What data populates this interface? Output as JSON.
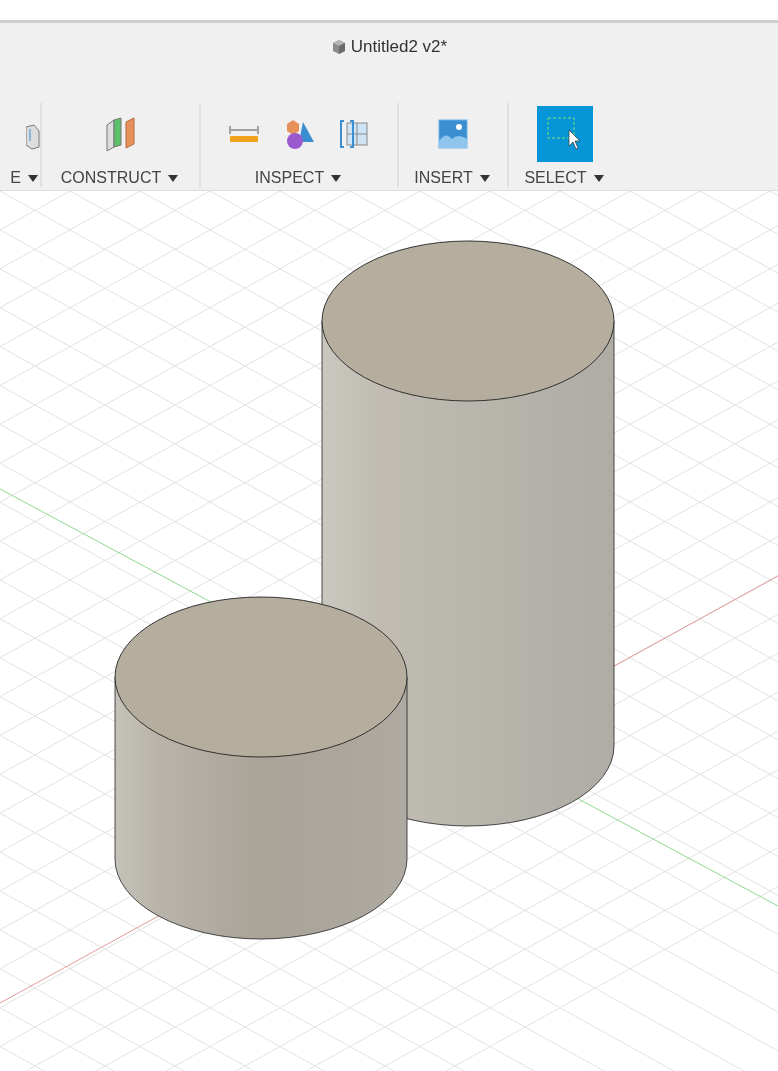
{
  "window": {
    "title": "Untitled2 v2*"
  },
  "toolbar": {
    "groups": [
      {
        "label": "E",
        "tools": [
          {
            "kind": "partial",
            "selected": false
          }
        ]
      },
      {
        "label": "CONSTRUCT",
        "tools": [
          {
            "kind": "planes",
            "selected": false
          }
        ]
      },
      {
        "label": "INSPECT",
        "tools": [
          {
            "kind": "measure",
            "selected": false
          },
          {
            "kind": "shapes",
            "selected": false
          },
          {
            "kind": "section",
            "selected": false
          }
        ]
      },
      {
        "label": "INSERT",
        "tools": [
          {
            "kind": "image",
            "selected": false
          }
        ]
      },
      {
        "label": "SELECT",
        "tools": [
          {
            "kind": "select",
            "selected": true
          }
        ]
      }
    ]
  }
}
